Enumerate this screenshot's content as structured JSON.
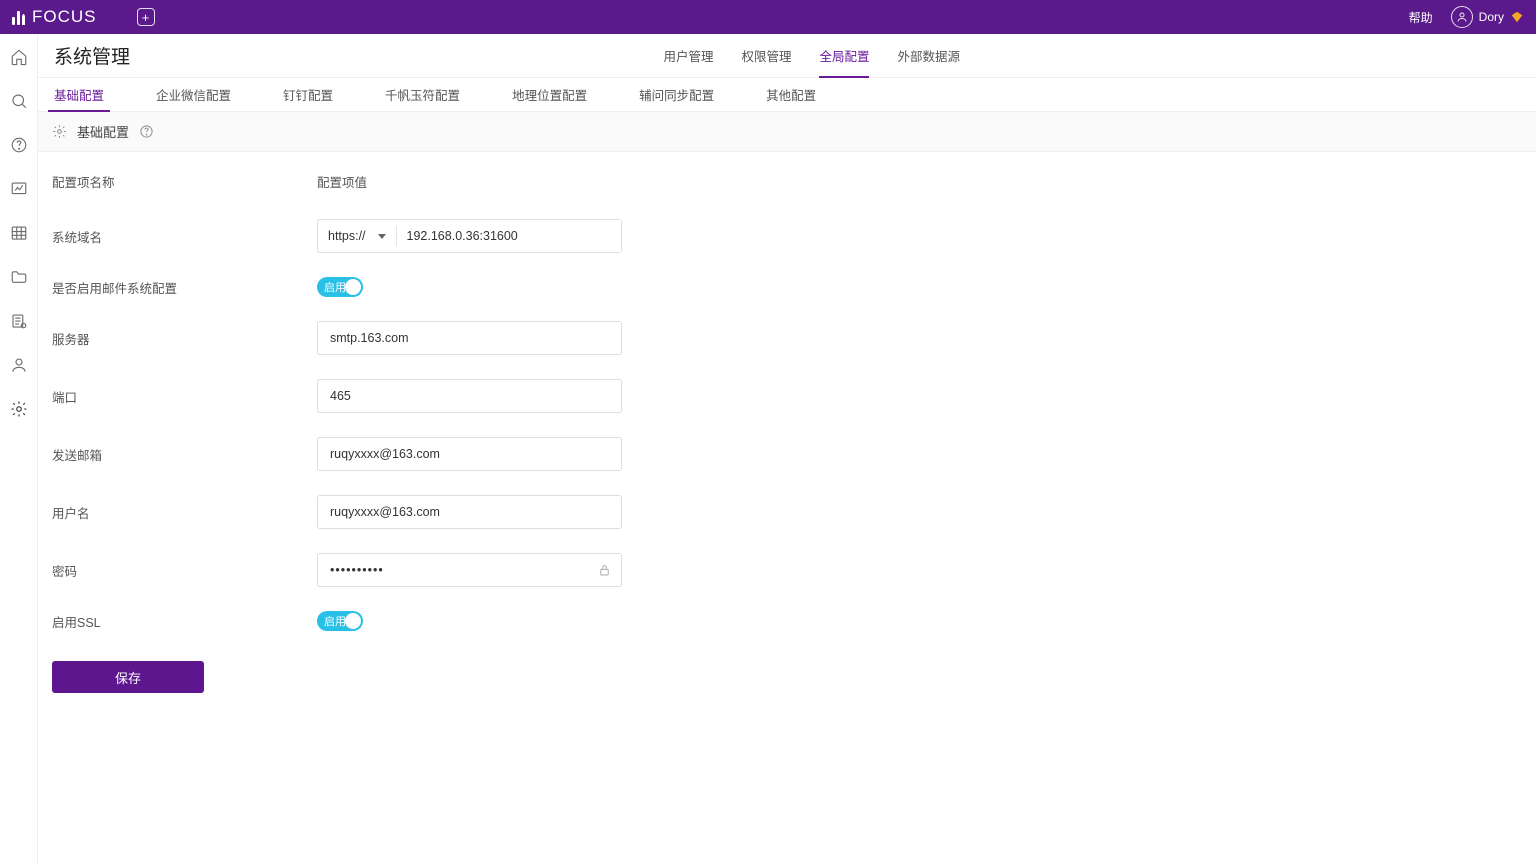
{
  "brand": "FOCUS",
  "topbar": {
    "help": "帮助",
    "user": "Dory"
  },
  "page": {
    "title": "系统管理"
  },
  "top_tabs": [
    "用户管理",
    "权限管理",
    "全局配置",
    "外部数据源"
  ],
  "top_tab_active": 2,
  "sub_tabs": [
    "基础配置",
    "企业微信配置",
    "钉钉配置",
    "千帆玉符配置",
    "地理位置配置",
    "辅问同步配置",
    "其他配置"
  ],
  "sub_tab_active": 0,
  "section": {
    "title": "基础配置"
  },
  "form_headers": {
    "name": "配置项名称",
    "value": "配置项值"
  },
  "form": {
    "domain_label": "系统域名",
    "domain_protocol": "https://",
    "domain_value": "192.168.0.36:31600",
    "enable_mail_label": "是否启用邮件系统配置",
    "enable_mail_toggle_text": "启用",
    "server_label": "服务器",
    "server_value": "smtp.163.com",
    "port_label": "端口",
    "port_value": "465",
    "from_label": "发送邮箱",
    "from_value": "ruqyxxxx@163.com",
    "user_label": "用户名",
    "user_value": "ruqyxxxx@163.com",
    "pw_label": "密码",
    "pw_value": "••••••••••",
    "ssl_label": "启用SSL",
    "ssl_toggle_text": "启用",
    "save_label": "保存"
  },
  "side_icons": [
    "home",
    "search",
    "help",
    "chart",
    "grid",
    "folder",
    "list-settings",
    "user",
    "settings"
  ]
}
